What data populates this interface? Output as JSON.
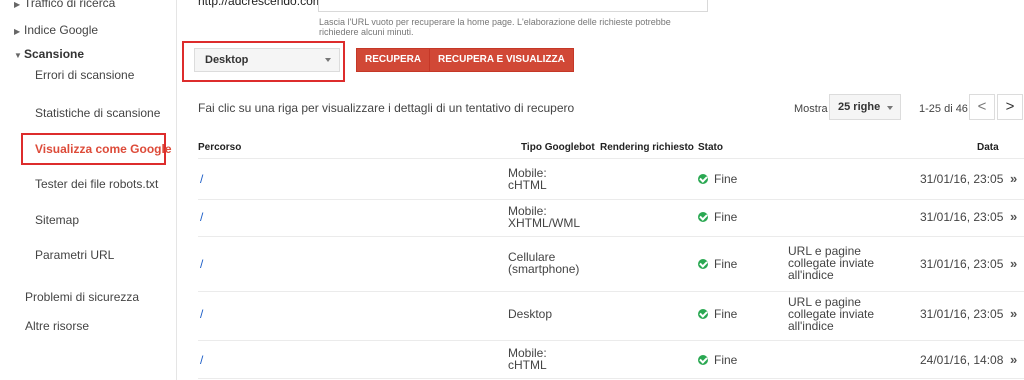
{
  "sidebar": {
    "items": [
      {
        "label": "Traffico di ricerca"
      },
      {
        "label": "Indice Google"
      },
      {
        "label": "Scansione"
      },
      {
        "label": "Errori di scansione"
      },
      {
        "label": "Statistiche di scansione"
      },
      {
        "label": "Visualizza come Google"
      },
      {
        "label": "Tester dei file robots.txt"
      },
      {
        "label": "Sitemap"
      },
      {
        "label": "Parametri URL"
      },
      {
        "label": "Problemi di sicurezza"
      },
      {
        "label": "Altre risorse"
      }
    ]
  },
  "fetch": {
    "url_prefix": "http://adcrescendo.com/",
    "url_value": "",
    "hint": "Lascia l'URL vuoto per recuperare la home page. L'elaborazione delle richieste potrebbe richiedere alcuni minuti.",
    "device_select": "Desktop",
    "btn_fetch": "RECUPERA",
    "btn_fetch_render": "RECUPERA E VISUALIZZA"
  },
  "list": {
    "info": "Fai clic su una riga per visualizzare i dettagli di un tentativo di recupero",
    "show_label": "Mostra",
    "rows_select": "25 righe",
    "page_info": "1-25 di 46",
    "headers": {
      "path": "Percorso",
      "bot_type": "Tipo Googlebot",
      "render": "Rendering richiesto",
      "status": "Stato",
      "date": "Data"
    },
    "rows": [
      {
        "path": "/",
        "bot1": "Mobile:",
        "bot2": "cHTML",
        "status": "Fine",
        "note1": "",
        "note2": "",
        "note3": "",
        "date": "31/01/16, 23:05"
      },
      {
        "path": "/",
        "bot1": "Mobile:",
        "bot2": "XHTML/WML",
        "status": "Fine",
        "note1": "",
        "note2": "",
        "note3": "",
        "date": "31/01/16, 23:05"
      },
      {
        "path": "/",
        "bot1": "Cellulare",
        "bot2": "(smartphone)",
        "status": "Fine",
        "note1": "URL e pagine",
        "note2": "collegate inviate",
        "note3": "all'indice",
        "date": "31/01/16, 23:05"
      },
      {
        "path": "/",
        "bot1": "Desktop",
        "bot2": "",
        "status": "Fine",
        "note1": "URL e pagine",
        "note2": "collegate inviate",
        "note3": "all'indice",
        "date": "31/01/16, 23:05"
      },
      {
        "path": "/",
        "bot1": "Mobile:",
        "bot2": "cHTML",
        "status": "Fine",
        "note1": "",
        "note2": "",
        "note3": "",
        "date": "24/01/16, 14:08"
      }
    ]
  },
  "colors": {
    "accent_red": "#d14836",
    "highlight_border": "#dd2c2c",
    "link_blue": "#1a5cc7",
    "success_green": "#2aa852"
  },
  "icons": {
    "row_open": "chevron-double-right-icon",
    "status_ok": "check-circle-icon"
  }
}
